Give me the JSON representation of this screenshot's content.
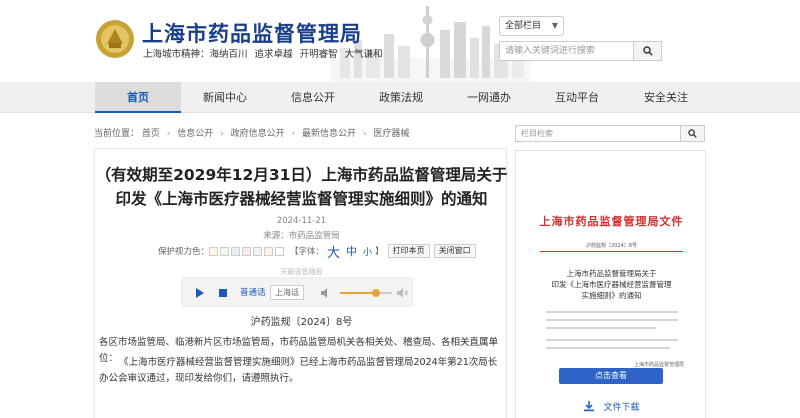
{
  "site": {
    "title": "上海市药品监督管理局",
    "slogan": [
      "上海城市精神：海纳百川",
      "追求卓越",
      "开明睿智",
      "大气谦和"
    ]
  },
  "search": {
    "scope": "全部栏目",
    "placeholder": "请输入关键词进行搜索"
  },
  "nav": {
    "items": [
      {
        "label": "首页",
        "active": true
      },
      {
        "label": "新闻中心",
        "active": false
      },
      {
        "label": "信息公开",
        "active": false
      },
      {
        "label": "政策法规",
        "active": false
      },
      {
        "label": "一网通办",
        "active": false
      },
      {
        "label": "互动平台",
        "active": false
      },
      {
        "label": "安全关注",
        "active": false
      }
    ]
  },
  "breadcrumb": {
    "prefix": "当前位置：",
    "items": [
      "首页",
      "信息公开",
      "政府信息公开",
      "最新信息公开",
      "医疗器械"
    ]
  },
  "article": {
    "title_line1": "（有效期至2029年12月31日）上海市药品监督管理局关于",
    "title_line2": "印发《上海市医疗器械经营监督管理实施细则》的通知",
    "date": "2024-11-21",
    "source_label": "来源：",
    "source": "市药品监管局",
    "tools": {
      "eye_label": "保护视力色：",
      "font_label": "【字体：",
      "font_big": "大",
      "font_mid": "中",
      "font_small": "小",
      "font_close": "】",
      "print_btn": "打印本页",
      "close_btn": "关闭窗口"
    },
    "audio": {
      "label": "天籁语音播报",
      "voice": "普通话",
      "alt_voice": "上海话",
      "volume": 0.7
    },
    "doc_number": "沪药监规〔2024〕8号",
    "para1": "各区市场监管局、临港新片区市场监管局，市药品监管局机关各相关处、稽查局、各相关直属单位：",
    "para2": "《上海市医疗器械经营监督管理实施细则》已经上海市药品监督管理局2024年第21次局长办公会审议通过，现印发给你们，请遵照执行。"
  },
  "sidebar": {
    "search_placeholder": "栏目检索",
    "doc_preview": {
      "header": "上海市药品监督管理局文件",
      "number": "沪药监规〔2024〕8号",
      "title_l1": "上海市药品监督管理局关于",
      "title_l2": "印发《上海市医疗器械经营监督管理",
      "title_l3": "实施细则》的通知",
      "sign": "上海市药品监督管理局"
    },
    "view_btn": "点击查看",
    "download": "文件下载"
  },
  "colors": {
    "brand_blue": "#1a3f8a",
    "link_blue": "#1a5bb5",
    "doc_red": "#d32f2f",
    "button_blue": "#2e64c7",
    "volume_orange": "#e9a23b"
  },
  "icons": {
    "search": "search-icon",
    "logo": "emblem-logo",
    "play": "play-icon",
    "pause": "pause-icon",
    "speaker": "speaker-icon",
    "mute": "mute-icon",
    "download": "download-icon"
  }
}
